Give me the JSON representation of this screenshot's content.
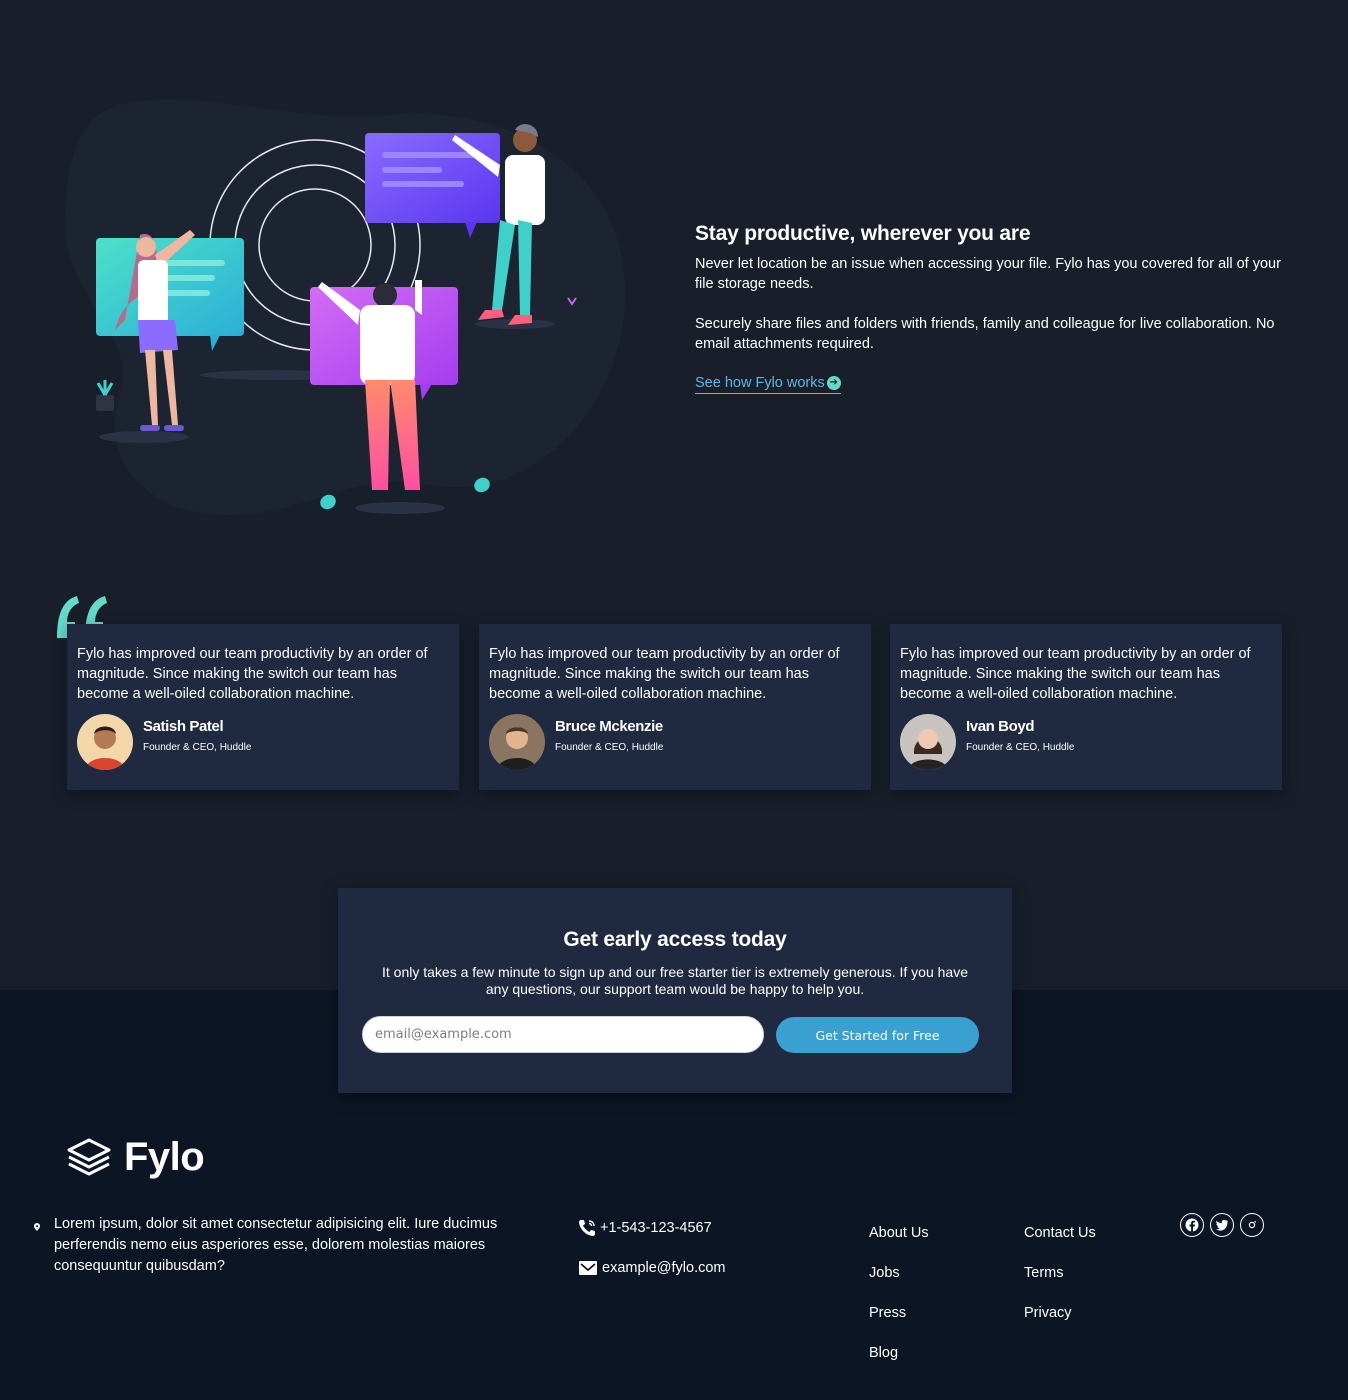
{
  "productive": {
    "title": "Stay productive, wherever you are",
    "paragraph1": "Never let location be an issue when accessing your file. Fylo has you covered for all of your file storage needs.",
    "paragraph2": "Securely share files and folders with friends, family and colleague for live collaboration. No email attachments required.",
    "link_label": "See how Fylo works",
    "link_icon": "arrow-circle-icon"
  },
  "testimonials": [
    {
      "quote": "Fylo has improved our team productivity by an order of magnitude. Since making the switch our team has become a well-oiled collaboration machine.",
      "name": "Satish Patel",
      "role": "Founder & CEO, Huddle"
    },
    {
      "quote": "Fylo has improved our team productivity by an order of magnitude. Since making the switch our team has become a well-oiled collaboration machine.",
      "name": "Bruce Mckenzie",
      "role": "Founder & CEO, Huddle"
    },
    {
      "quote": "Fylo has improved our team productivity by an order of magnitude. Since making the switch our team has become a well-oiled collaboration machine.",
      "name": "Ivan Boyd",
      "role": "Founder & CEO, Huddle"
    }
  ],
  "access": {
    "title": "Get early access today",
    "description": "It only takes a few minute to sign up and our free starter tier is extremely generous. If you have any questions, our support team would be happy to help you.",
    "email_placeholder": "email@example.com",
    "email_value": "",
    "button_label": "Get Started for Free"
  },
  "footer": {
    "logo_text": "Fylo",
    "address": "Lorem ipsum, dolor sit amet consectetur adipisicing elit. Iure ducimus perferendis nemo eius asperiores esse, dolorem molestias maiores consequuntur quibusdam?",
    "phone": "+1-543-123-4567",
    "email": "example@fylo.com",
    "links_col1": [
      "About Us",
      "Jobs",
      "Press",
      "Blog"
    ],
    "links_col2": [
      "Contact Us",
      "Terms",
      "Privacy"
    ],
    "social_icons": [
      "facebook-icon",
      "twitter-icon",
      "instagram-icon"
    ]
  },
  "colors": {
    "background": "#181f2a",
    "footer_background": "#0c1523",
    "card_background": "#1f2940",
    "link": "#5fb7e3",
    "accent_cyan": "#63dbc9",
    "button": "#3a9fd1"
  }
}
